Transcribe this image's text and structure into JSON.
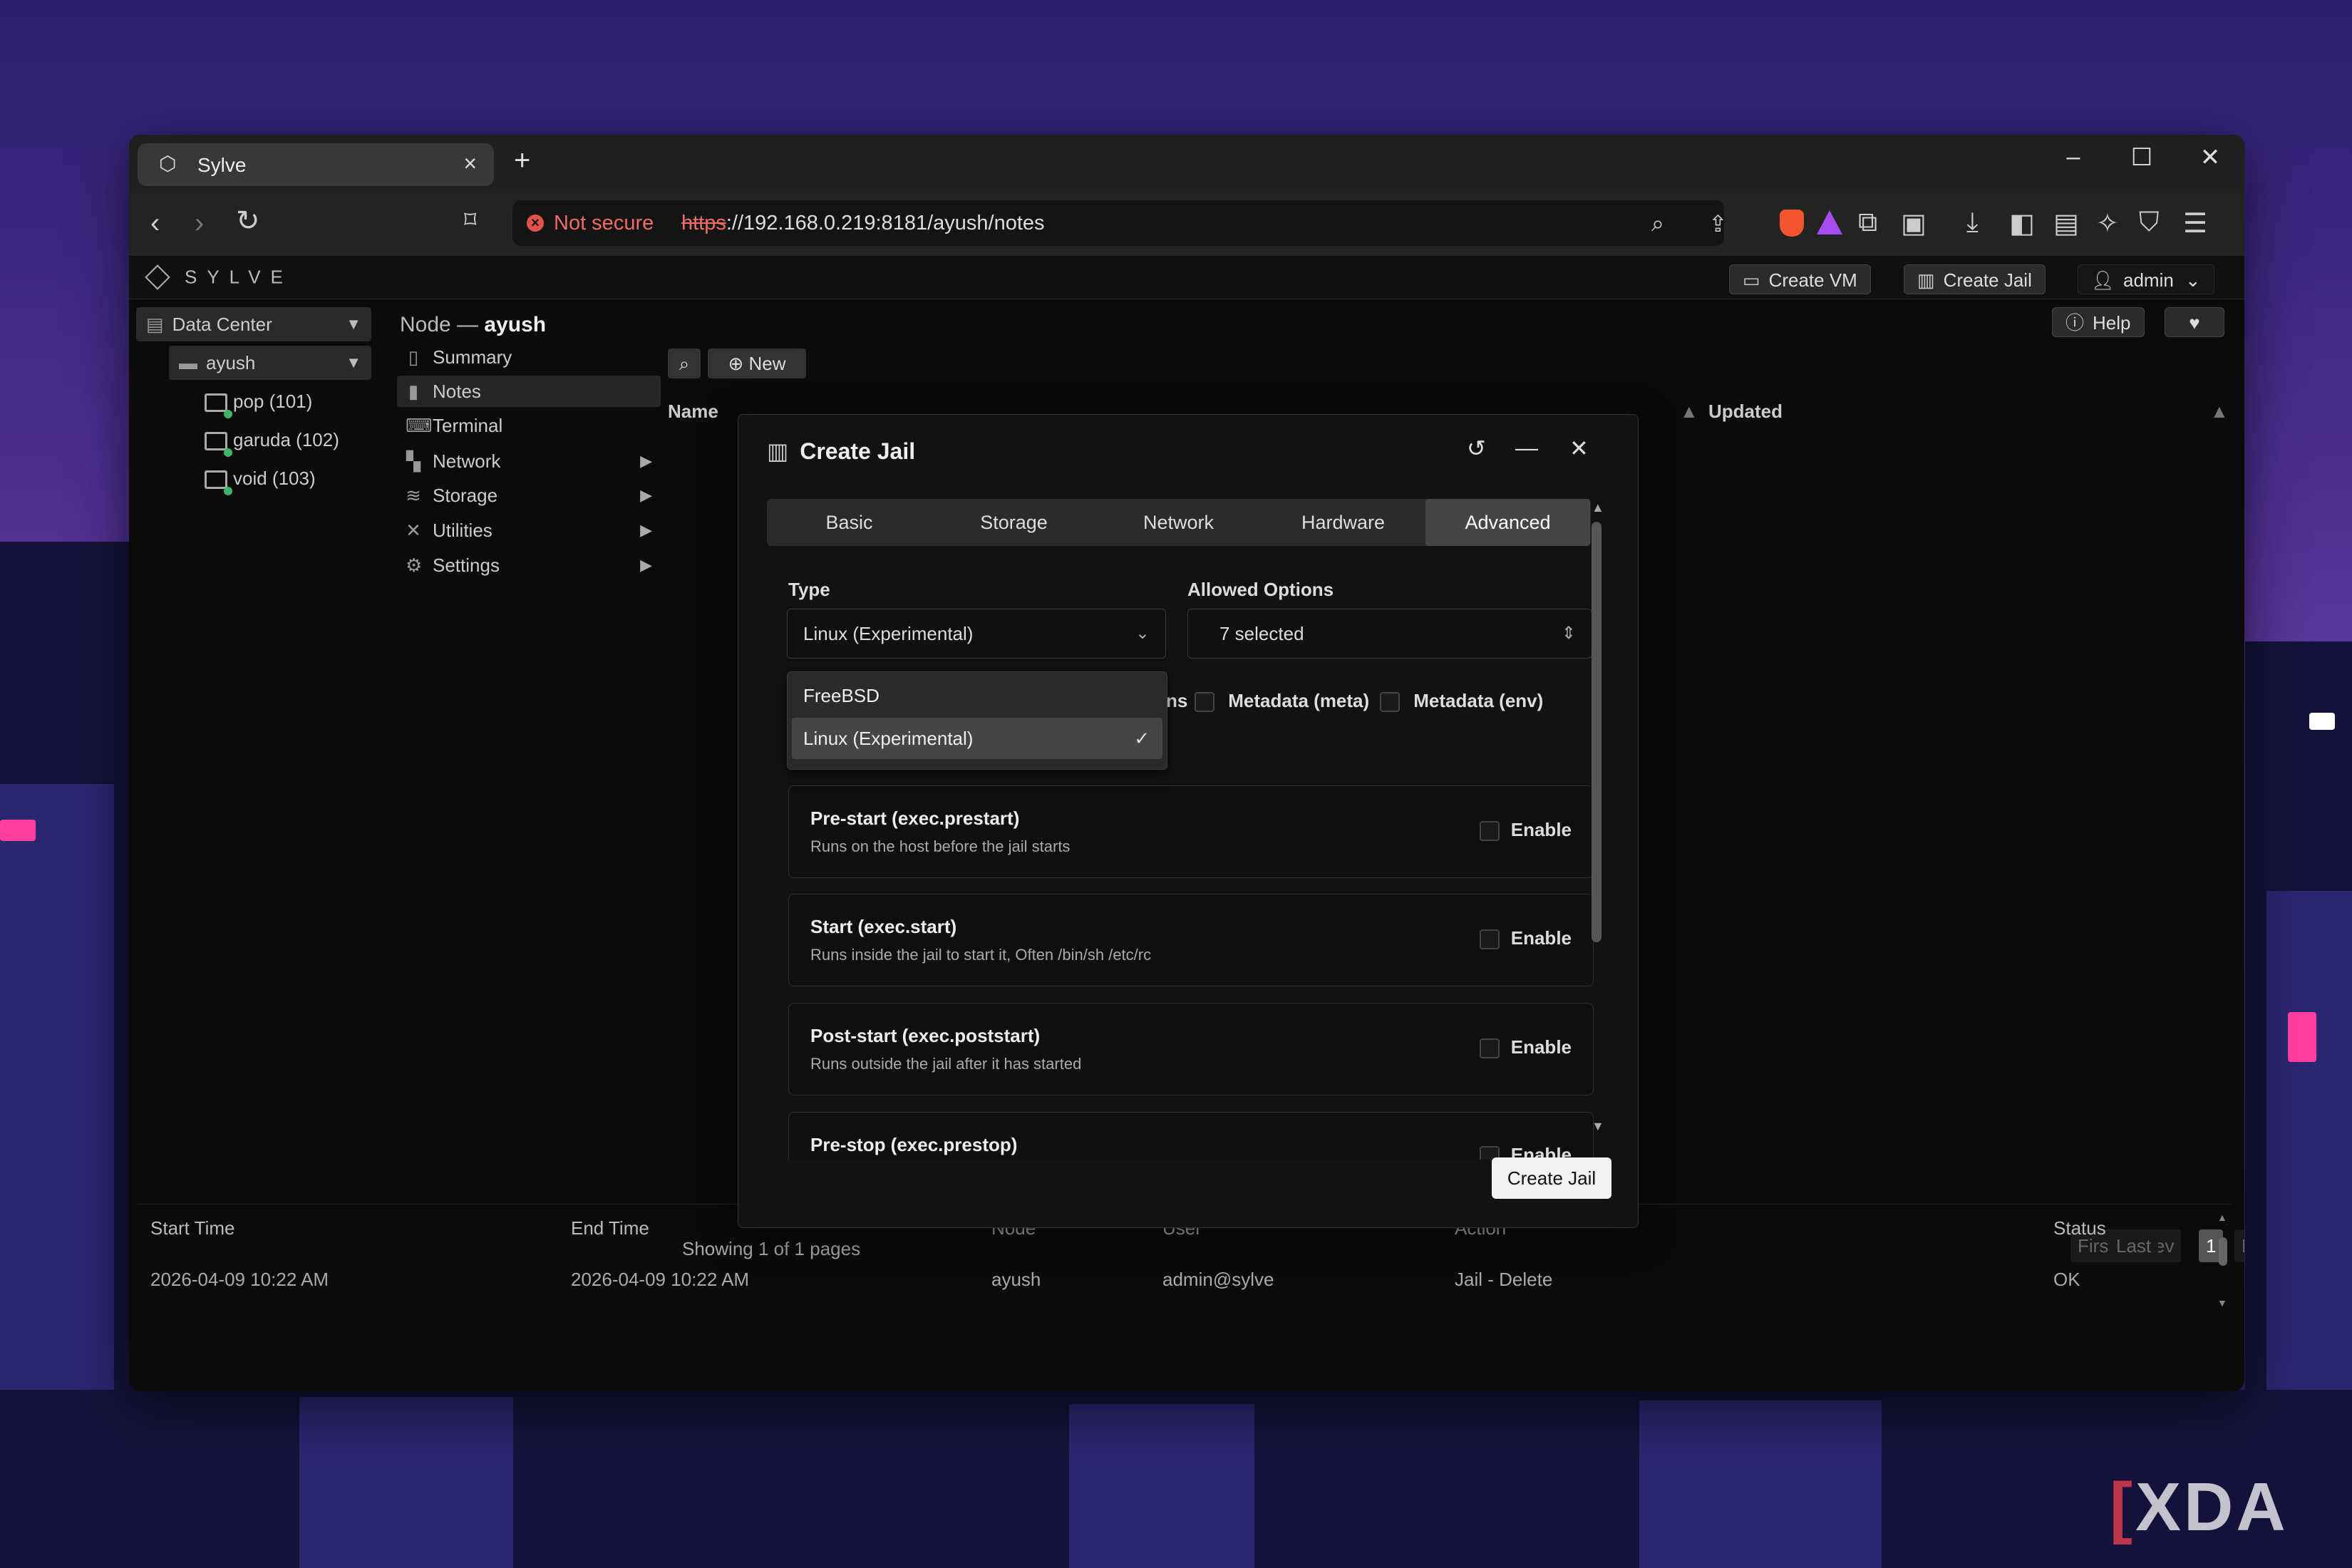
{
  "browser": {
    "tab_title": "Sylve",
    "not_secure": "Not secure",
    "url_scheme": "https",
    "url_rest": "://192.168.0.219:8181/ayush/notes"
  },
  "app": {
    "logo_text": "SYLVE",
    "header": {
      "create_vm": "Create VM",
      "create_jail": "Create Jail",
      "user": "admin",
      "help": "Help"
    },
    "tree": {
      "datacenter": "Data Center",
      "node": "ayush",
      "vms": [
        "pop (101)",
        "garuda (102)",
        "void (103)"
      ]
    },
    "breadcrumb": {
      "prefix": "Node — ",
      "node": "ayush"
    },
    "nav": [
      "Summary",
      "Notes",
      "Terminal",
      "Network",
      "Storage",
      "Utilities",
      "Settings"
    ],
    "content": {
      "new_label": "New",
      "col_name": "Name",
      "col_updated": "Updated",
      "showing": "Showing 1 of 1 pages",
      "pagination": [
        "First",
        "Prev",
        "1",
        "Next",
        "Last"
      ]
    },
    "log": {
      "headers": [
        "Start Time",
        "End Time",
        "Node",
        "User",
        "Action",
        "Status"
      ],
      "row": [
        "2026-04-09 10:22 AM",
        "2026-04-09 10:22 AM",
        "ayush",
        "admin@sylve",
        "Jail - Delete",
        "OK"
      ]
    }
  },
  "modal": {
    "title": "Create Jail",
    "tabs": [
      "Basic",
      "Storage",
      "Network",
      "Hardware",
      "Advanced"
    ],
    "active_tab": "Advanced",
    "type_label": "Type",
    "type_value": "Linux (Experimental)",
    "allowed_label": "Allowed Options",
    "allowed_value": "7 selected",
    "type_options": [
      "FreeBSD",
      "Linux (Experimental)"
    ],
    "partial_text": "ns",
    "meta_options": [
      "Metadata (meta)",
      "Metadata (env)"
    ],
    "hooks": [
      {
        "title": "Pre-start (exec.prestart)",
        "desc": "Runs on the host before the jail starts",
        "enable": "Enable"
      },
      {
        "title": "Start (exec.start)",
        "desc": "Runs inside the jail to start it, Often /bin/sh /etc/rc",
        "enable": "Enable"
      },
      {
        "title": "Post-start (exec.poststart)",
        "desc": "Runs outside the jail after it has started",
        "enable": "Enable"
      },
      {
        "title": "Pre-stop (exec.prestop)",
        "desc": "",
        "enable": "Enable"
      }
    ],
    "submit": "Create Jail"
  },
  "watermark": "XDA",
  "colors": {
    "not_secure": "#f06b62",
    "accent_green": "#3bb56b"
  }
}
